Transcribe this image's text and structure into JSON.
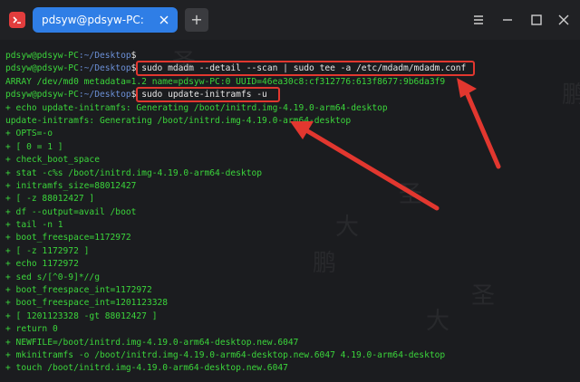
{
  "window": {
    "tab_title": "pdsyw@pdsyw-PC: ~/Desktop",
    "new_tab_label": "+"
  },
  "terminal": {
    "prompt_user": "pdsyw@pdsyw-PC",
    "prompt_path": ":~/Desktop",
    "prompt_symbol": "$",
    "lines": [
      {
        "type": "prompt",
        "cmd": ""
      },
      {
        "type": "prompt",
        "cmd": " sudo mdadm --detail --scan | sudo tee -a /etc/mdadm/mdadm.conf"
      },
      {
        "type": "out",
        "text": "ARRAY /dev/md0 metadata=1.2 name=pdsyw-PC:0 UUID=46ea30c8:cf312776:613f8677:9b6da3f9"
      },
      {
        "type": "prompt",
        "cmd": " sudo update-initramfs -u"
      },
      {
        "type": "out",
        "text": "+ echo update-initramfs: Generating /boot/initrd.img-4.19.0-arm64-desktop"
      },
      {
        "type": "out",
        "text": "update-initramfs: Generating /boot/initrd.img-4.19.0-arm64-desktop"
      },
      {
        "type": "out",
        "text": "+ OPTS=-o"
      },
      {
        "type": "out",
        "text": "+ [ 0 = 1 ]"
      },
      {
        "type": "out",
        "text": "+ check_boot_space"
      },
      {
        "type": "out",
        "text": "+ stat -c%s /boot/initrd.img-4.19.0-arm64-desktop"
      },
      {
        "type": "out",
        "text": "+ initramfs_size=88012427"
      },
      {
        "type": "out",
        "text": "+ [ -z 88012427 ]"
      },
      {
        "type": "out",
        "text": "+ df --output=avail /boot"
      },
      {
        "type": "out",
        "text": "+ tail -n 1"
      },
      {
        "type": "out",
        "text": "+ boot_freespace=1172972"
      },
      {
        "type": "out",
        "text": "+ [ -z 1172972 ]"
      },
      {
        "type": "out",
        "text": "+ echo 1172972"
      },
      {
        "type": "out",
        "text": "+ sed s/[^0-9]*//g"
      },
      {
        "type": "out",
        "text": "+ boot_freespace_int=1172972"
      },
      {
        "type": "out",
        "text": "+ boot_freespace_int=1201123328"
      },
      {
        "type": "out",
        "text": "+ [ 1201123328 -gt 88012427 ]"
      },
      {
        "type": "out",
        "text": "+ return 0"
      },
      {
        "type": "out",
        "text": "+ NEWFILE=/boot/initrd.img-4.19.0-arm64-desktop.new.6047"
      },
      {
        "type": "out",
        "text": "+ mkinitramfs -o /boot/initrd.img-4.19.0-arm64-desktop.new.6047 4.19.0-arm64-desktop"
      },
      {
        "type": "out",
        "text": "+ touch /boot/initrd.img-4.19.0-arm64-desktop.new.6047"
      }
    ]
  },
  "colors": {
    "highlight": "#e2372f",
    "prompt_green": "#3bd53b",
    "tab_blue": "#2f7ee6"
  },
  "watermark": [
    "大",
    "圣",
    "鹏"
  ]
}
